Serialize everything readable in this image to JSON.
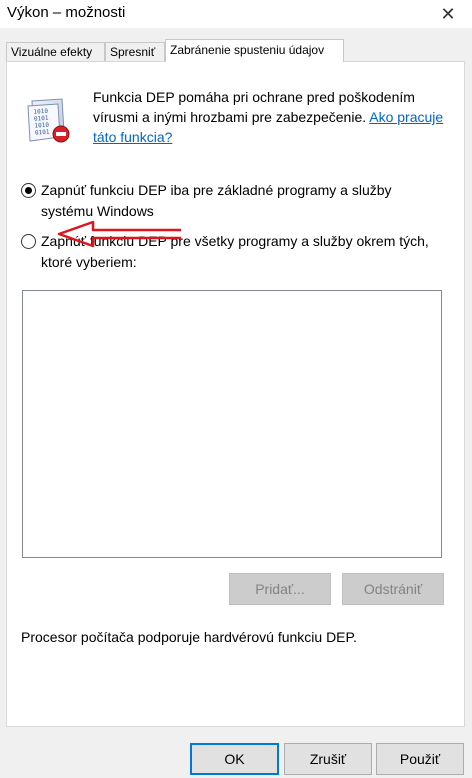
{
  "window": {
    "title": "Výkon – možnosti",
    "close_glyph": "✕"
  },
  "tabs": [
    {
      "label": "Vizuálne efekty",
      "active": false
    },
    {
      "label": "Spresniť",
      "active": false
    },
    {
      "label": "Zabránenie spusteniu údajov",
      "active": true
    }
  ],
  "dep": {
    "intro_text": "Funkcia DEP pomáha pri ochrane pred poškodením vírusmi a inými hrozbami pre zabezpečenie. ",
    "intro_link": "Ako pracuje táto funkcia?",
    "icon_digits": [
      "1010",
      "0101",
      "1010",
      "0101"
    ],
    "option1_label": "Zapnúť funkciu DEP iba pre základné programy a služby systému Windows",
    "option1_selected": true,
    "option2_label": "Zapnúť funkciu DEP pre všetky programy a služby okrem tých, ktoré vyberiem:",
    "option2_selected": false,
    "add_label": "Pridať...",
    "remove_label": "Odstrániť",
    "cpu_note": "Procesor počítača podporuje hardvérovú funkciu DEP."
  },
  "dialog_buttons": {
    "ok": "OK",
    "cancel": "Zrušiť",
    "apply": "Použiť"
  },
  "colors": {
    "link": "#0066cc",
    "annotation_arrow": "#e0141e",
    "default_button_border": "#0078d7"
  }
}
